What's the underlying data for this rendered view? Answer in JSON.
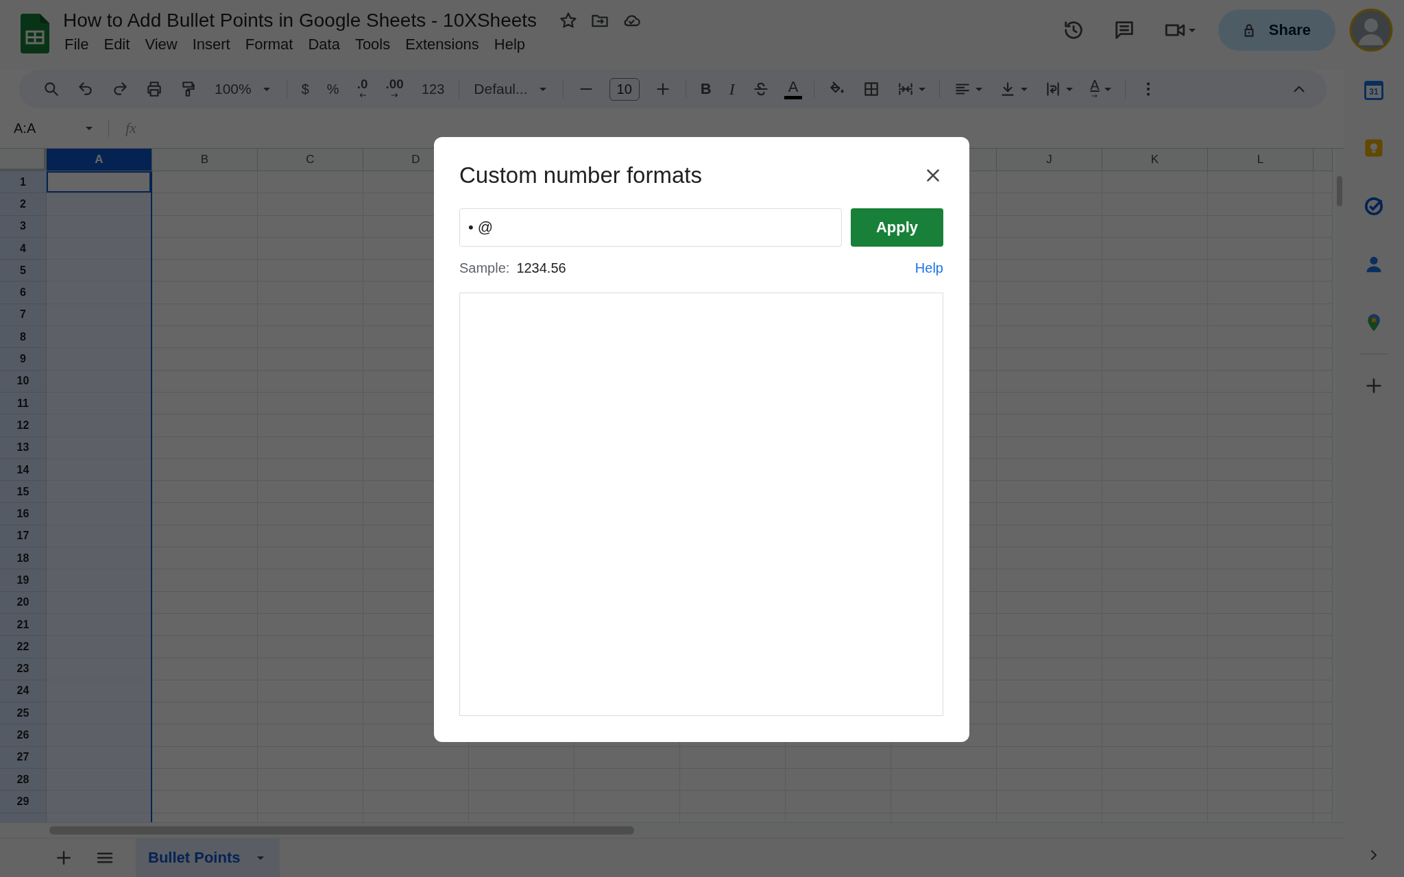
{
  "document": {
    "title": "How to Add Bullet Points in Google Sheets - 10XSheets"
  },
  "menu": [
    "File",
    "Edit",
    "View",
    "Insert",
    "Format",
    "Data",
    "Tools",
    "Extensions",
    "Help"
  ],
  "share_button": {
    "label": "Share"
  },
  "toolbar": {
    "groups": [
      [
        {
          "kind": "search"
        },
        {
          "kind": "undo"
        },
        {
          "kind": "redo"
        },
        {
          "kind": "print"
        },
        {
          "kind": "paint"
        },
        {
          "kind": "dropdown",
          "label": "100%"
        }
      ],
      [
        {
          "kind": "text",
          "label": "$"
        },
        {
          "kind": "text",
          "label": "%"
        },
        {
          "kind": "decimal_less",
          "label": ".0"
        },
        {
          "kind": "decimal_more",
          "label": ".00"
        },
        {
          "kind": "text",
          "label": "123"
        }
      ],
      [
        {
          "kind": "dropdown",
          "label": "Defaul..."
        }
      ],
      [
        {
          "kind": "minus"
        },
        {
          "kind": "field",
          "label": "10"
        },
        {
          "kind": "plus"
        }
      ],
      [
        {
          "kind": "bold",
          "label": "B"
        },
        {
          "kind": "italic",
          "label": "I"
        },
        {
          "kind": "strike"
        },
        {
          "kind": "textcolor",
          "label": "A"
        }
      ],
      [
        {
          "kind": "fill"
        },
        {
          "kind": "borders"
        },
        {
          "kind": "merge"
        }
      ],
      [
        {
          "kind": "halign"
        },
        {
          "kind": "valign"
        },
        {
          "kind": "wrap"
        },
        {
          "kind": "rotate",
          "label": "A"
        }
      ],
      [
        {
          "kind": "more"
        }
      ]
    ]
  },
  "formula_bar": {
    "name_box": "A:A",
    "function_label": "fx"
  },
  "grid": {
    "columns": [
      {
        "label": "A",
        "selected": true
      },
      {
        "label": "B",
        "selected": false
      },
      {
        "label": "C",
        "selected": false
      },
      {
        "label": "D",
        "selected": false,
        "covered_after": true
      },
      {
        "label": "J",
        "selected": false
      },
      {
        "label": "K",
        "selected": false
      },
      {
        "label": "L",
        "selected": false
      }
    ],
    "rows": [
      "1",
      "2",
      "3",
      "4",
      "5",
      "6",
      "7",
      "8",
      "9",
      "10",
      "11",
      "12",
      "13",
      "14",
      "15",
      "16",
      "17",
      "18",
      "19",
      "20",
      "21",
      "22",
      "23",
      "24",
      "25",
      "26",
      "27",
      "28",
      "29"
    ]
  },
  "sheet_tabs": [
    {
      "label": "Bullet Points",
      "selected": true
    }
  ],
  "side_panel": [
    {
      "kind": "calendar",
      "label": "31"
    },
    {
      "kind": "keep"
    },
    {
      "kind": "tasks"
    },
    {
      "kind": "contacts"
    },
    {
      "kind": "maps"
    }
  ],
  "dialog": {
    "title": "Custom number formats",
    "format_input": {
      "value": "• @"
    },
    "apply_button": "Apply",
    "sample_label": "Sample:",
    "sample_value": "1234.56",
    "help_link": "Help"
  }
}
